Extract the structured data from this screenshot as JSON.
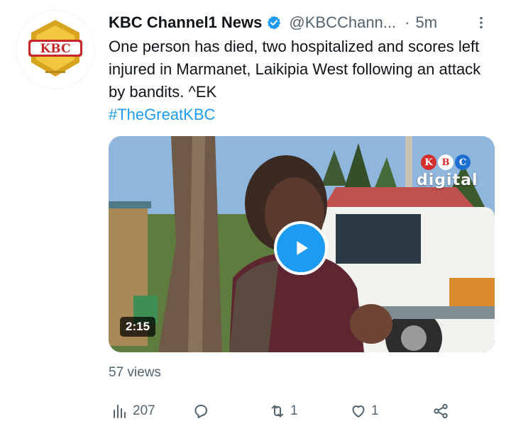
{
  "tweet": {
    "author": {
      "display_name": "KBC Channel1 News",
      "handle": "@KBCChann...",
      "separator": "·",
      "timestamp": "5m",
      "verified": true,
      "avatar_text": "KBC"
    },
    "body_text": "One person has died, two hospitalized and scores left injured in Marmanet, Laikipia West following an attack by bandits. ^EK",
    "hashtag": "#TheGreatKBC",
    "media": {
      "type": "video",
      "duration": "2:15",
      "watermark_letters": [
        "K",
        "B",
        "C"
      ],
      "watermark_word": "digital"
    },
    "views": "57 views",
    "actions": {
      "analytics_count": "207",
      "reply_count": "",
      "retweet_count": "1",
      "like_count": "1"
    },
    "colors": {
      "accent": "#1d9bf0",
      "secondary_text": "#536471",
      "primary_text": "#0f1419",
      "avatar_gold": "#d8a31f",
      "avatar_red": "#d32f2f"
    },
    "icons": {
      "verified": "verified-badge-icon",
      "more": "more-icon",
      "play": "play-icon",
      "analytics": "analytics-icon",
      "reply": "reply-icon",
      "retweet": "retweet-icon",
      "like": "like-icon",
      "share": "share-icon"
    }
  }
}
